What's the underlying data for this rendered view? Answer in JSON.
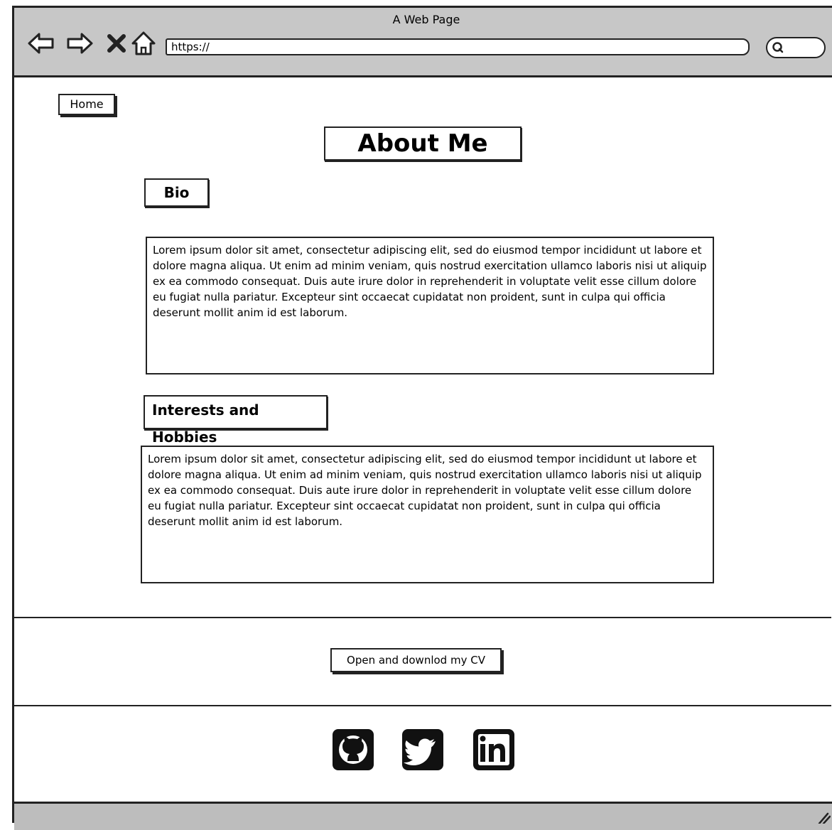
{
  "window": {
    "title": "A Web Page",
    "url": "https://"
  },
  "nav": {
    "home_label": "Home"
  },
  "page": {
    "title": "About Me",
    "bio_heading": "Bio",
    "bio_text": "Lorem ipsum dolor sit amet, consectetur adipiscing elit, sed do eiusmod tempor incididunt ut labore et dolore magna aliqua. Ut enim ad minim veniam, quis nostrud exercitation ullamco laboris nisi ut aliquip ex ea commodo consequat. Duis aute irure dolor in reprehenderit in voluptate velit esse cillum dolore eu fugiat nulla pariatur. Excepteur sint occaecat cupidatat non proident, sunt in culpa qui officia deserunt mollit anim id est laborum.",
    "interests_heading": "Interests and Hobbies",
    "interests_text": "Lorem ipsum dolor sit amet, consectetur adipiscing elit, sed do eiusmod tempor incididunt ut labore et dolore magna aliqua. Ut enim ad minim veniam, quis nostrud exercitation ullamco laboris nisi ut aliquip ex ea commodo consequat. Duis aute irure dolor in reprehenderit in voluptate velit esse cillum dolore eu fugiat nulla pariatur. Excepteur sint occaecat cupidatat non proident, sunt in culpa qui officia deserunt mollit anim id est laborum."
  },
  "cv": {
    "button_label": "Open and downlod my CV"
  },
  "social": [
    {
      "icon": "github-icon"
    },
    {
      "icon": "twitter-icon"
    },
    {
      "icon": "linkedin-icon"
    }
  ],
  "colors": {
    "chrome": "#c7c7c7",
    "ink": "#222222",
    "background": "#ffffff"
  }
}
